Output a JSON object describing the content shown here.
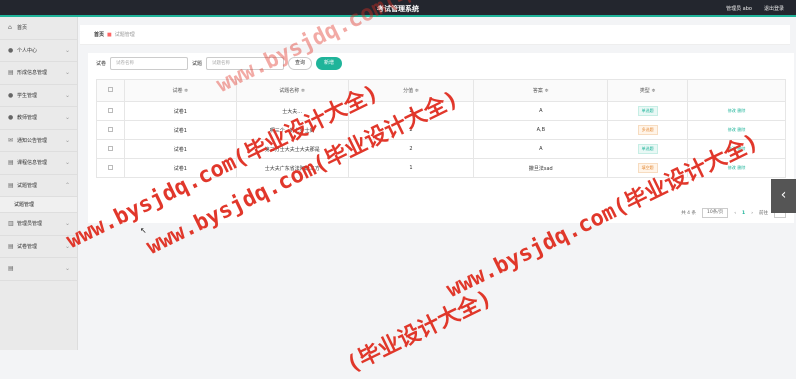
{
  "header": {
    "title": "考试管理系统",
    "user_label": "管理员 abo",
    "logout_label": "退出登录"
  },
  "sidebar": {
    "items": [
      {
        "icon": "home-icon",
        "glyph": "⌂",
        "label": "首页"
      },
      {
        "icon": "user-icon",
        "glyph": "●",
        "label": "个人中心"
      },
      {
        "icon": "doc-icon",
        "glyph": "▤",
        "label": "形成信息管理"
      },
      {
        "icon": "student-icon",
        "glyph": "●",
        "label": "学生管理"
      },
      {
        "icon": "teacher-icon",
        "glyph": "●",
        "label": "教师管理"
      },
      {
        "icon": "notice-icon",
        "glyph": "✉",
        "label": "通知公告管理"
      },
      {
        "icon": "course-icon",
        "glyph": "▤",
        "label": "课程信息管理"
      },
      {
        "icon": "exam-icon",
        "glyph": "▤",
        "label": "试题管理"
      }
    ],
    "sub_item": "试题管理",
    "items_after": [
      {
        "icon": "chart-icon",
        "glyph": "▥",
        "label": "管理员管理"
      },
      {
        "icon": "paper-icon",
        "glyph": "▤",
        "label": "试卷管理"
      },
      {
        "icon": "extra-icon",
        "glyph": "▤",
        "label": ""
      }
    ]
  },
  "breadcrumb": {
    "home": "首页",
    "current": "试题管理"
  },
  "search": {
    "field1_label": "试卷",
    "field1_placeholder": "试卷名称",
    "field2_label": "试题",
    "field2_placeholder": "试题名称",
    "query_button": "查询",
    "add_button": "新增"
  },
  "table": {
    "headers": [
      "试卷 ≑",
      "试题名称 ≑",
      "分值 ≑",
      "答案 ≑",
      "类型 ≑"
    ],
    "rows": [
      {
        "paper": "试卷1",
        "question": "士大夫...",
        "score": "2",
        "answer": "A",
        "type": "单选题",
        "type_style": "a"
      },
      {
        "paper": "试卷1",
        "question": "啊三个...的七步士封",
        "score": "2",
        "answer": "A,B",
        "type": "多选题",
        "type_style": "b"
      },
      {
        "paper": "试卷1",
        "question": "第三方士大夫士大夫那是",
        "score": "2",
        "answer": "A",
        "type": "单选题",
        "type_style": "a"
      },
      {
        "paper": "试卷1",
        "question": "士大夫广东省法阿斯三方",
        "score": "1",
        "answer": "撒旦法sad",
        "type": "填空题",
        "type_style": "b"
      }
    ],
    "op_edit": "修改",
    "op_delete": "删除"
  },
  "pager": {
    "total": "共 4 条",
    "page_size": "10条/页",
    "prev": "‹",
    "current_page": "1",
    "next": "›",
    "goto_label": "前往",
    "goto_value": "1"
  },
  "side_tab": {
    "icon": "chevron-left-icon",
    "glyph": "‹"
  },
  "watermarks": [
    "www.bysjdq.com(毕业设计大全)",
    "www.bysjdq.com(毕业设计大全)",
    "www.bysjdq.com(毕业设计大全)",
    "www.bysjdq.com(毕业设计大全)",
    "(毕业设计大全)"
  ],
  "colors": {
    "accent": "#1fb49a",
    "topbar": "#23262e",
    "watermark": "#e02d20"
  }
}
